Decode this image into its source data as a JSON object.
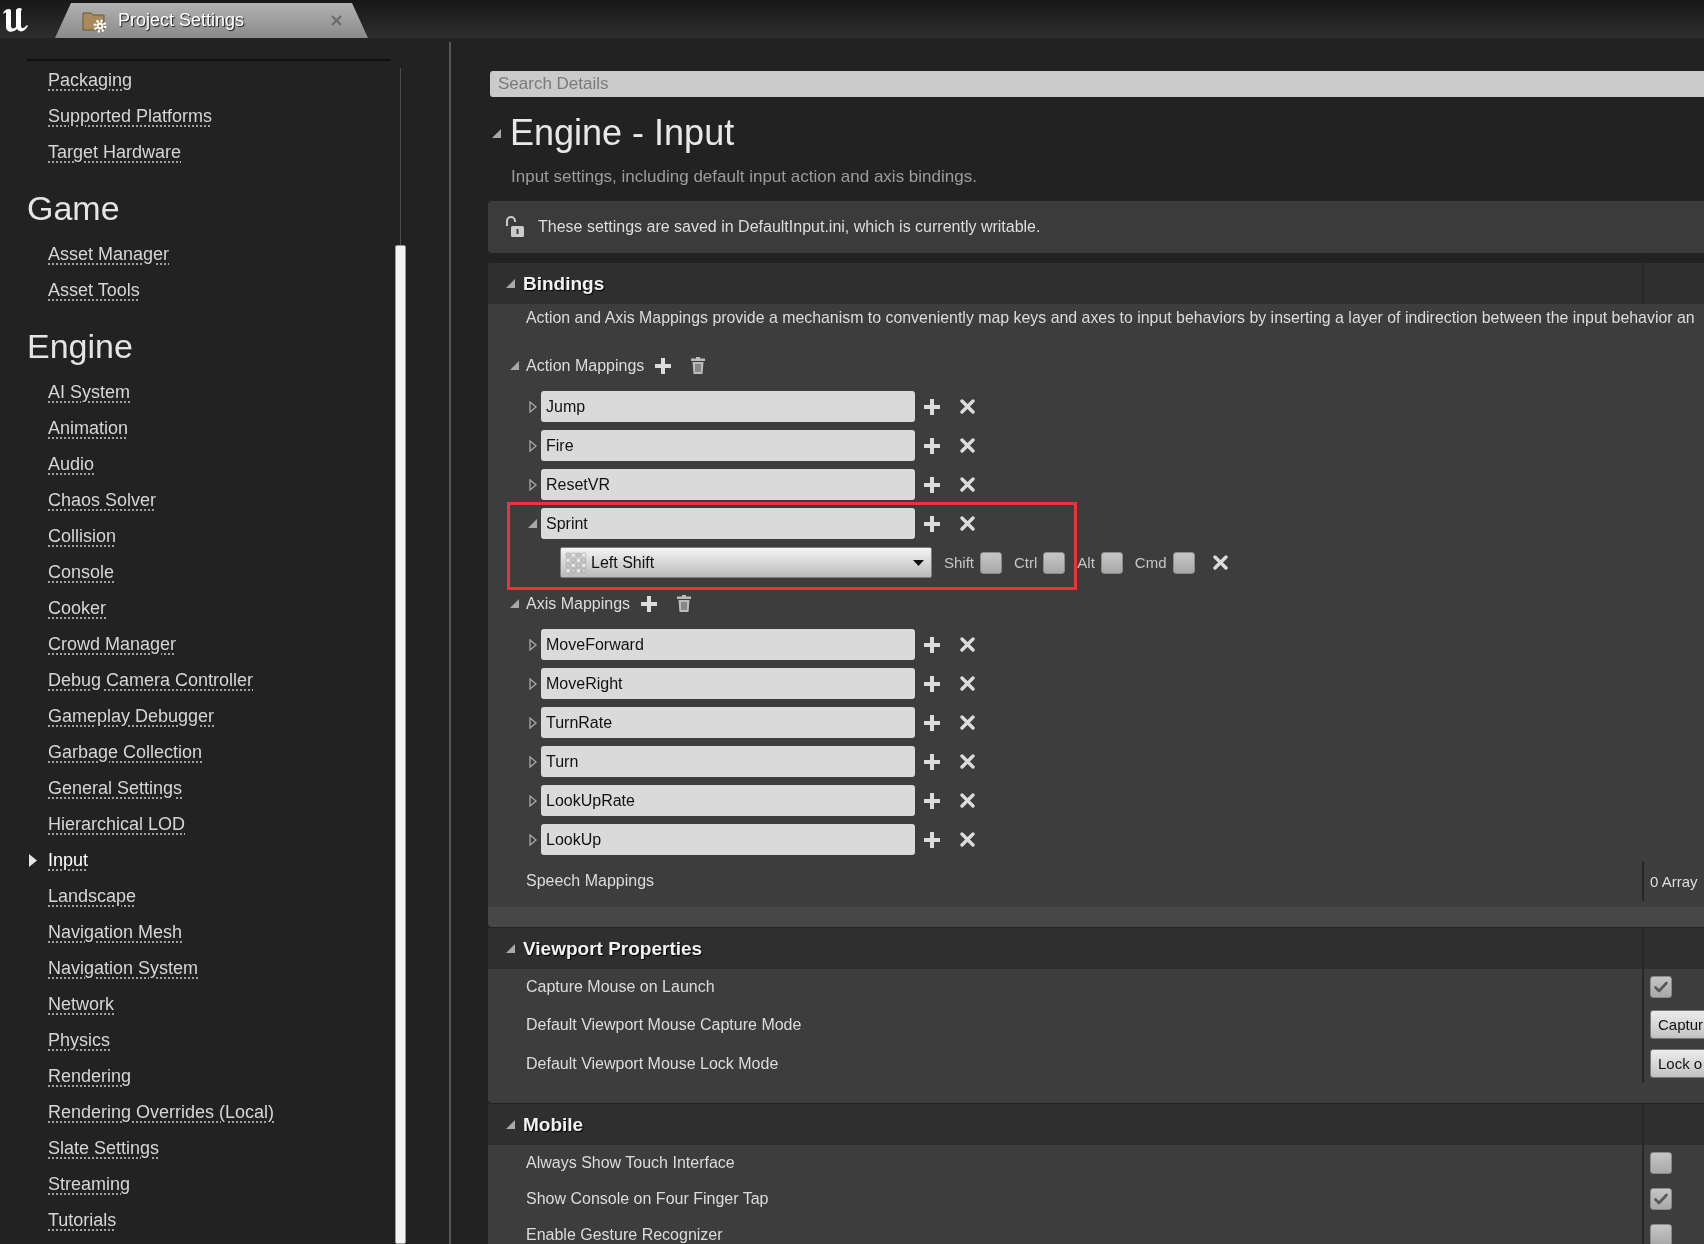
{
  "tab": {
    "title": "Project Settings",
    "selected": true
  },
  "sidebar": {
    "sections": [
      {
        "items": [
          {
            "label": "Packaging",
            "selected": false
          },
          {
            "label": "Supported Platforms",
            "selected": false
          },
          {
            "label": "Target Hardware",
            "selected": false
          }
        ]
      },
      {
        "title": "Game",
        "items": [
          {
            "label": "Asset Manager",
            "selected": false
          },
          {
            "label": "Asset Tools",
            "selected": false
          }
        ]
      },
      {
        "title": "Engine",
        "items": [
          {
            "label": "AI System",
            "selected": false
          },
          {
            "label": "Animation",
            "selected": false
          },
          {
            "label": "Audio",
            "selected": false
          },
          {
            "label": "Chaos Solver",
            "selected": false
          },
          {
            "label": "Collision",
            "selected": false
          },
          {
            "label": "Console",
            "selected": false
          },
          {
            "label": "Cooker",
            "selected": false
          },
          {
            "label": "Crowd Manager",
            "selected": false
          },
          {
            "label": "Debug Camera Controller",
            "selected": false
          },
          {
            "label": "Gameplay Debugger",
            "selected": false
          },
          {
            "label": "Garbage Collection",
            "selected": false
          },
          {
            "label": "General Settings",
            "selected": false
          },
          {
            "label": "Hierarchical LOD",
            "selected": false
          },
          {
            "label": "Input",
            "selected": true
          },
          {
            "label": "Landscape",
            "selected": false
          },
          {
            "label": "Navigation Mesh",
            "selected": false
          },
          {
            "label": "Navigation System",
            "selected": false
          },
          {
            "label": "Network",
            "selected": false
          },
          {
            "label": "Physics",
            "selected": false
          },
          {
            "label": "Rendering",
            "selected": false
          },
          {
            "label": "Rendering Overrides (Local)",
            "selected": false
          },
          {
            "label": "Slate Settings",
            "selected": false
          },
          {
            "label": "Streaming",
            "selected": false
          },
          {
            "label": "Tutorials",
            "selected": false
          }
        ]
      }
    ]
  },
  "details": {
    "search": {
      "placeholder": "Search Details"
    },
    "title": "Engine - Input",
    "expanded": true,
    "subtitle": "Input settings, including default input action and axis bindings.",
    "notice": "These settings are saved in DefaultInput.ini, which is currently writable.",
    "sections": [
      {
        "title": "Bindings",
        "expanded": true,
        "advanced": true,
        "description": "Action and Axis Mappings provide a mechanism to conveniently map keys and axes to input behaviors by inserting a layer of indirection between the input behavior an",
        "groups": [
          {
            "title": "Action Mappings",
            "expanded": true,
            "mappings": [
              {
                "name": "Jump",
                "expanded": false,
                "highlighted": false
              },
              {
                "name": "Fire",
                "expanded": false,
                "highlighted": false
              },
              {
                "name": "ResetVR",
                "expanded": false,
                "highlighted": false
              },
              {
                "name": "Sprint",
                "expanded": true,
                "highlighted": true,
                "keys": [
                  {
                    "key": "Left Shift",
                    "modifiers": [
                      {
                        "label": "Shift",
                        "checked": false
                      },
                      {
                        "label": "Ctrl",
                        "checked": false
                      },
                      {
                        "label": "Alt",
                        "checked": false
                      },
                      {
                        "label": "Cmd",
                        "checked": false
                      }
                    ]
                  }
                ]
              }
            ]
          },
          {
            "title": "Axis Mappings",
            "expanded": true,
            "mappings": [
              {
                "name": "MoveForward",
                "expanded": false,
                "highlighted": false
              },
              {
                "name": "MoveRight",
                "expanded": false,
                "highlighted": false
              },
              {
                "name": "TurnRate",
                "expanded": false,
                "highlighted": false
              },
              {
                "name": "Turn",
                "expanded": false,
                "highlighted": false
              },
              {
                "name": "LookUpRate",
                "expanded": false,
                "highlighted": false
              },
              {
                "name": "LookUp",
                "expanded": false,
                "highlighted": false
              }
            ]
          }
        ],
        "properties": [
          {
            "kind": "text",
            "label": "Speech Mappings",
            "value": "0 Array"
          }
        ]
      },
      {
        "title": "Viewport Properties",
        "expanded": true,
        "advanced": false,
        "properties": [
          {
            "kind": "checkbox",
            "label": "Capture Mouse on Launch",
            "checked": true
          },
          {
            "kind": "dropdown",
            "label": "Default Viewport Mouse Capture Mode",
            "value": "Captur"
          },
          {
            "kind": "dropdown",
            "label": "Default Viewport Mouse Lock Mode",
            "value": "Lock o"
          }
        ]
      },
      {
        "title": "Mobile",
        "expanded": true,
        "advanced": false,
        "properties": [
          {
            "kind": "checkbox",
            "label": "Always Show Touch Interface",
            "checked": false
          },
          {
            "kind": "checkbox",
            "label": "Show Console on Four Finger Tap",
            "checked": true
          },
          {
            "kind": "checkbox",
            "label": "Enable Gesture Recognizer",
            "checked": false
          }
        ]
      }
    ]
  }
}
